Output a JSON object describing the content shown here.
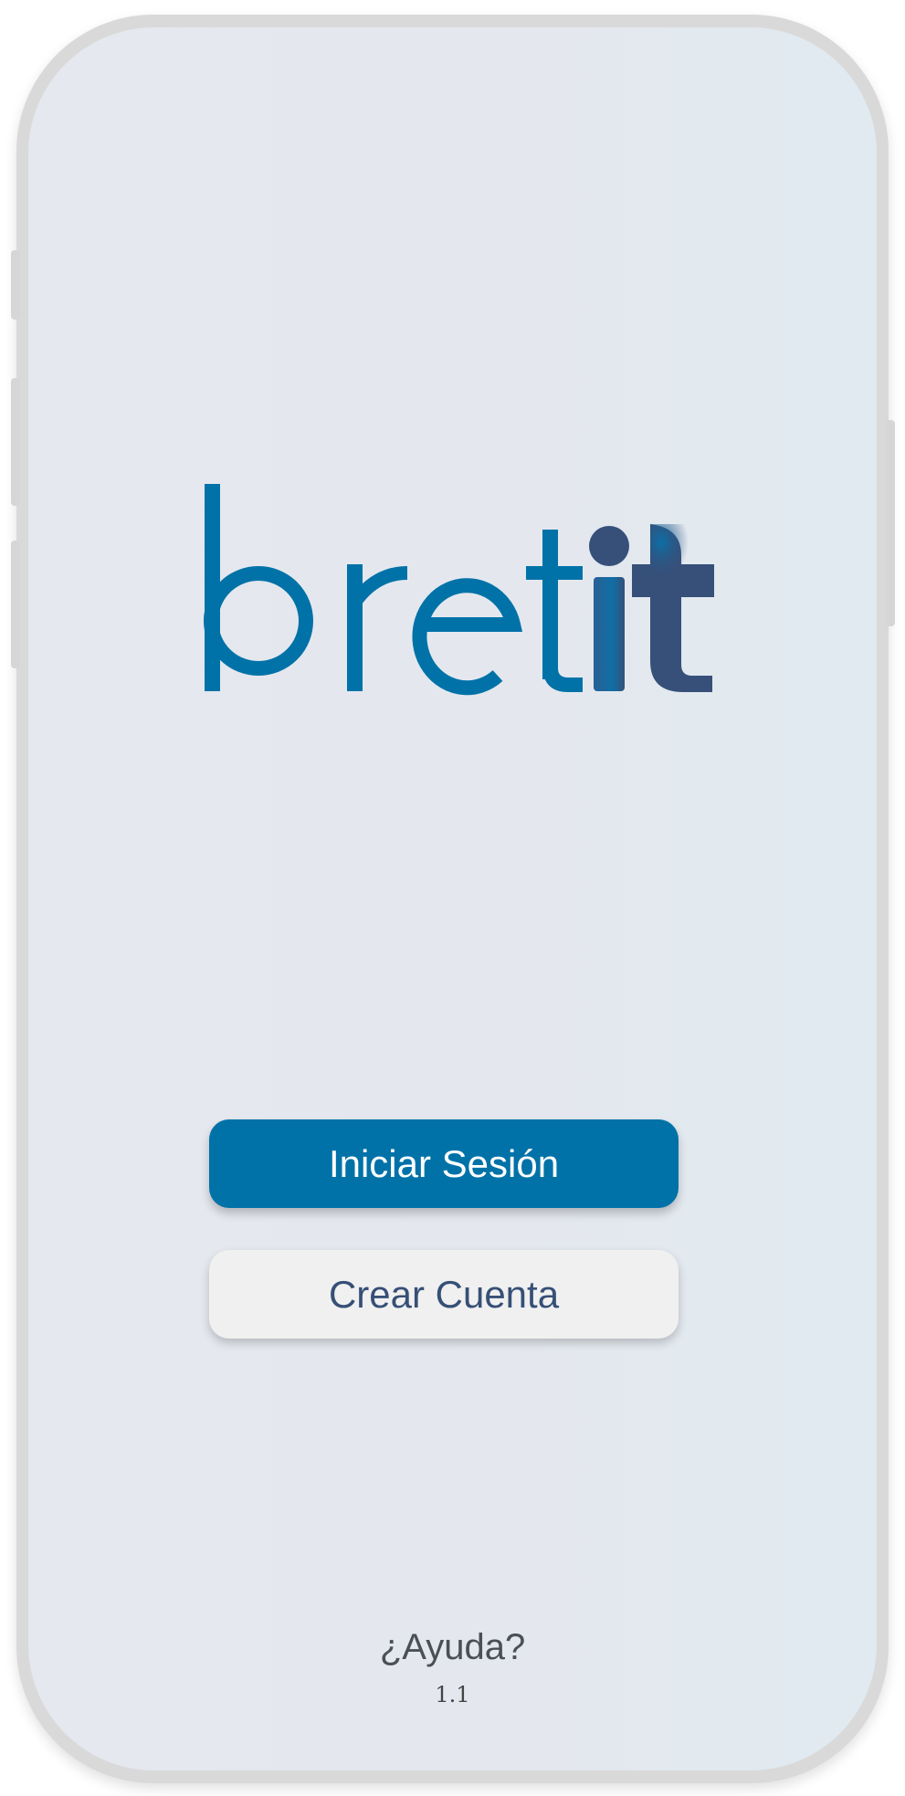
{
  "app": {
    "logo_text": "bretit"
  },
  "actions": {
    "login_label": "Iniciar Sesión",
    "create_account_label": "Crear Cuenta"
  },
  "footer": {
    "help_label": "¿Ayuda?",
    "version": "1.1"
  },
  "colors": {
    "brand_blue": "#0072a8",
    "brand_navy": "#364f76",
    "screen_background": "#e4e8ee",
    "secondary_button": "#f0f0f0"
  }
}
